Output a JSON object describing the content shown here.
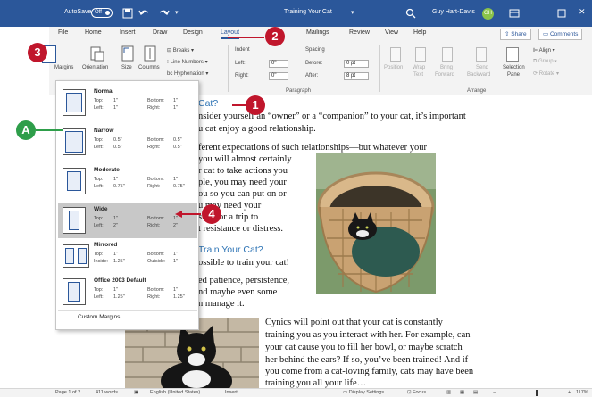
{
  "titlebar": {
    "autosave": "AutoSave",
    "autosave_state": "Off",
    "doc_title": "Training Your Cat",
    "user": "Guy Hart-Davis",
    "user_initials": "GH"
  },
  "tabs": [
    "File",
    "Home",
    "Insert",
    "Draw",
    "Design",
    "Layout",
    "Mailings",
    "Review",
    "View",
    "Help"
  ],
  "share": "Share",
  "comments": "Comments",
  "ribbon": {
    "margins": "Margins",
    "orientation": "Orientation",
    "size": "Size",
    "columns": "Columns",
    "breaks": "Breaks",
    "line_numbers": "Line Numbers",
    "hyphenation": "Hyphenation",
    "indent": "Indent",
    "indent_left_label": "Left:",
    "indent_left": "0\"",
    "indent_right_label": "Right:",
    "indent_right": "0\"",
    "spacing": "Spacing",
    "before_label": "Before:",
    "before": "0 pt",
    "after_label": "After:",
    "after": "8 pt",
    "paragraph": "Paragraph",
    "position": "Position",
    "wrap_text": [
      "Wrap",
      "Text"
    ],
    "bring_forward": [
      "Bring",
      "Forward"
    ],
    "send_backward": [
      "Send",
      "Backward"
    ],
    "selection_pane": [
      "Selection",
      "Pane"
    ],
    "align": "Align",
    "group": "Group",
    "rotate": "Rotate",
    "arrange": "Arrange"
  },
  "margins_menu": {
    "options": [
      {
        "name": "Normal",
        "r1a": "Top:",
        "r1b": "1\"",
        "r1c": "Bottom:",
        "r1d": "1\"",
        "r2a": "Left:",
        "r2b": "1\"",
        "r2c": "Right:",
        "r2d": "1\""
      },
      {
        "name": "Narrow",
        "r1a": "Top:",
        "r1b": "0.5\"",
        "r1c": "Bottom:",
        "r1d": "0.5\"",
        "r2a": "Left:",
        "r2b": "0.5\"",
        "r2c": "Right:",
        "r2d": "0.5\""
      },
      {
        "name": "Moderate",
        "r1a": "Top:",
        "r1b": "1\"",
        "r1c": "Bottom:",
        "r1d": "1\"",
        "r2a": "Left:",
        "r2b": "0.75\"",
        "r2c": "Right:",
        "r2d": "0.75\""
      },
      {
        "name": "Wide",
        "r1a": "Top:",
        "r1b": "1\"",
        "r1c": "Bottom:",
        "r1d": "1\"",
        "r2a": "Left:",
        "r2b": "2\"",
        "r2c": "Right:",
        "r2d": "2\""
      },
      {
        "name": "Mirrored",
        "r1a": "Top:",
        "r1b": "1\"",
        "r1c": "Bottom:",
        "r1d": "1\"",
        "r2a": "Inside:",
        "r2b": "1.25\"",
        "r2c": "Outside:",
        "r2d": "1\""
      },
      {
        "name": "Office 2003 Default",
        "r1a": "Top:",
        "r1b": "1\"",
        "r1c": "Bottom:",
        "r1d": "1\"",
        "r2a": "Left:",
        "r2b": "1.25\"",
        "r2c": "Right:",
        "r2d": "1.25\""
      }
    ],
    "custom": "Custom Margins..."
  },
  "document": {
    "heading1": "Cat?",
    "p1": [
      "nsider yourself an “owner” or a “companion” to your cat, it’s important",
      "u cat enjoy a good relationship."
    ],
    "p2": [
      "ferent expectations of such relationships—but whatever your",
      "you will almost certainly",
      "r cat to take actions you",
      "ple, you may need your",
      "ou so you can put on or",
      "u may need your",
      "sket for a trip to",
      "t resistance or distress."
    ],
    "heading2": "Train Your Cat?",
    "p3": [
      "ossible to train your cat!"
    ],
    "p4": [
      "ed patience, persistence,",
      "nd maybe even some",
      "n manage it."
    ],
    "p5": [
      "Cynics will point out that your cat is constantly",
      "training you as you interact with her. For example, can",
      "your cat cause you to fill her bowl, or maybe scratch",
      "her behind the ears? If so, you’ve been trained! And if",
      "you come from a cat-loving family, cats may have been",
      "training you all your life…"
    ]
  },
  "callouts": {
    "c1": "1",
    "c2": "2",
    "c3": "3",
    "c4": "4",
    "cA": "A"
  },
  "status": {
    "page": "Page 1 of 2",
    "words": "411 words",
    "language": "English (United States)",
    "mode": "Insert",
    "display": "Display Settings",
    "focus": "Focus",
    "zoom": "117%"
  },
  "colors": {
    "accent": "#2b579a",
    "callout_red": "#c0162c",
    "callout_green": "#2e9e4a",
    "heading": "#2e74b5"
  }
}
